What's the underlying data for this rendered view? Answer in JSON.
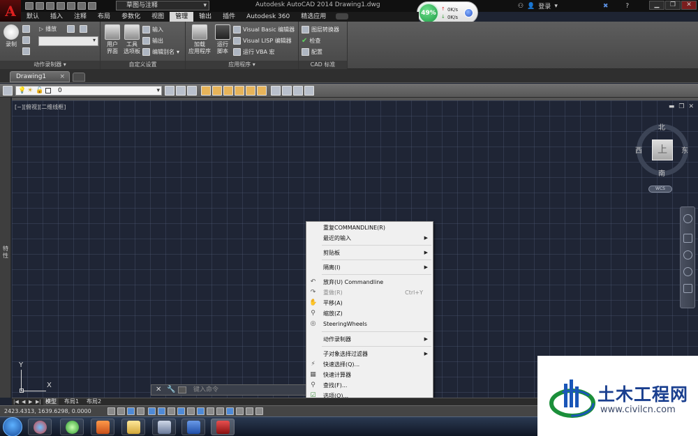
{
  "app": {
    "title": "Autodesk AutoCAD 2014    Drawing1.dwg",
    "app_button_letter": "A",
    "workspace": "草图与注释",
    "login": "登录",
    "accent": "#c01818"
  },
  "network_widget": {
    "percent": "49%",
    "up_rate": "0K/s",
    "down_rate": "0K/s"
  },
  "ribbon_tabs": [
    {
      "label": "默认"
    },
    {
      "label": "插入"
    },
    {
      "label": "注释"
    },
    {
      "label": "布局"
    },
    {
      "label": "参数化"
    },
    {
      "label": "视图"
    },
    {
      "label": "管理"
    },
    {
      "label": "输出"
    },
    {
      "label": "插件"
    },
    {
      "label": "Autodesk 360"
    },
    {
      "label": "精选应用"
    }
  ],
  "ribbon": {
    "action_recorder": {
      "record": "录制",
      "play": "播放",
      "title": "动作录制器"
    },
    "customization": {
      "user_interface": "用户\n界面",
      "tool_palettes": "工具\n选项板",
      "import": "输入",
      "export": "输出",
      "edit_aliases": "编辑别名",
      "title": "自定义设置"
    },
    "applications": {
      "load_application": "加载\n应用程序",
      "run_script": "运行\n脚本",
      "vba_editor": "Visual Basic 编辑器",
      "lisp_editor": "Visual LISP 编辑器",
      "run_vba": "运行 VBA 宏",
      "title": "应用程序"
    },
    "cad_standards": {
      "layer_translator": "图层转换器",
      "check": "检查",
      "configure": "配置",
      "title": "CAD 标准"
    }
  },
  "doc_tab": {
    "label": "Drawing1",
    "close": "×"
  },
  "layer": {
    "current": "0"
  },
  "left_strip": {
    "label": "特性"
  },
  "viewport": {
    "label": "[−][俯视][二维线框]",
    "min": "▬",
    "restore": "❐",
    "close": "✕"
  },
  "viewcube": {
    "face": "上",
    "north": "北",
    "south": "南",
    "east": "东",
    "west": "西",
    "wcs": "WCS"
  },
  "ucs": {
    "x": "X",
    "y": "Y"
  },
  "command_line": {
    "placeholder": "键入命令"
  },
  "context_menu": {
    "items": [
      {
        "label": "重复COMMANDLINE(R)"
      },
      {
        "label": "最近的输入",
        "submenu": "▶"
      },
      {
        "label": "剪贴板",
        "submenu": "▶"
      },
      {
        "label": "隔离(I)",
        "submenu": "▶"
      },
      {
        "label": "放弃(U) Commandline",
        "icon": "↶"
      },
      {
        "label": "重做(R)",
        "shortcut": "Ctrl+Y",
        "icon": "↷"
      },
      {
        "label": "平移(A)",
        "icon": "✋"
      },
      {
        "label": "缩放(Z)",
        "icon": "⚲"
      },
      {
        "label": "SteeringWheels",
        "icon": "◎"
      },
      {
        "label": "动作录制器",
        "submenu": "▶"
      },
      {
        "label": "子对象选择过滤器",
        "submenu": "▶"
      },
      {
        "label": "快速选择(Q)...",
        "icon": "⚡"
      },
      {
        "label": "快速计算器",
        "icon": "▦"
      },
      {
        "label": "查找(F)...",
        "icon": "⚲"
      },
      {
        "label": "选项(O)...",
        "icon": "☑"
      }
    ]
  },
  "layout_tabs": {
    "model": "模型",
    "layout1": "布局1",
    "layout2": "布局2"
  },
  "status": {
    "coords": "2423.4313, 1639.6298, 0.0000"
  },
  "watermark": {
    "title": "土木工程网",
    "url": "www.civilcn.com"
  }
}
